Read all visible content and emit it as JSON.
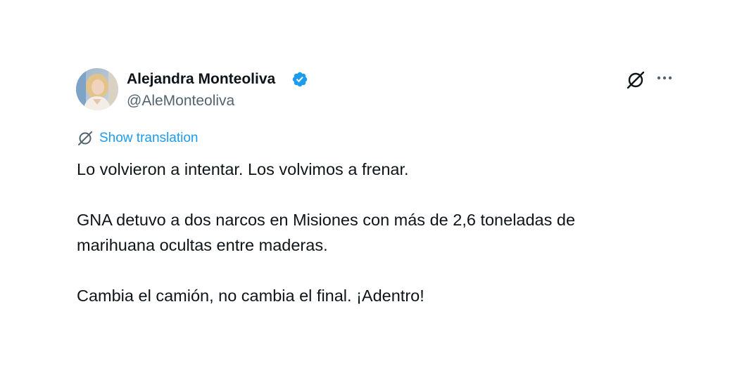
{
  "author": {
    "name": "Alejandra Monteoliva",
    "handle": "@AleMonteoliva",
    "verified": true,
    "verified_color": "#1d9bf0"
  },
  "actions": {
    "grok_icon": "grok-icon",
    "more_icon": "more-options-icon"
  },
  "translation": {
    "label": "Show translation",
    "color": "#1d9bf0"
  },
  "tweet": {
    "line1": "Lo volvieron a intentar. Los volvimos a frenar.",
    "line2": "GNA detuvo a dos narcos en Misiones con más de 2,6 toneladas de",
    "line3": "marihuana ocultas entre maderas.",
    "line4": "Cambia el camión, no cambia el final. ¡Adentro!"
  }
}
